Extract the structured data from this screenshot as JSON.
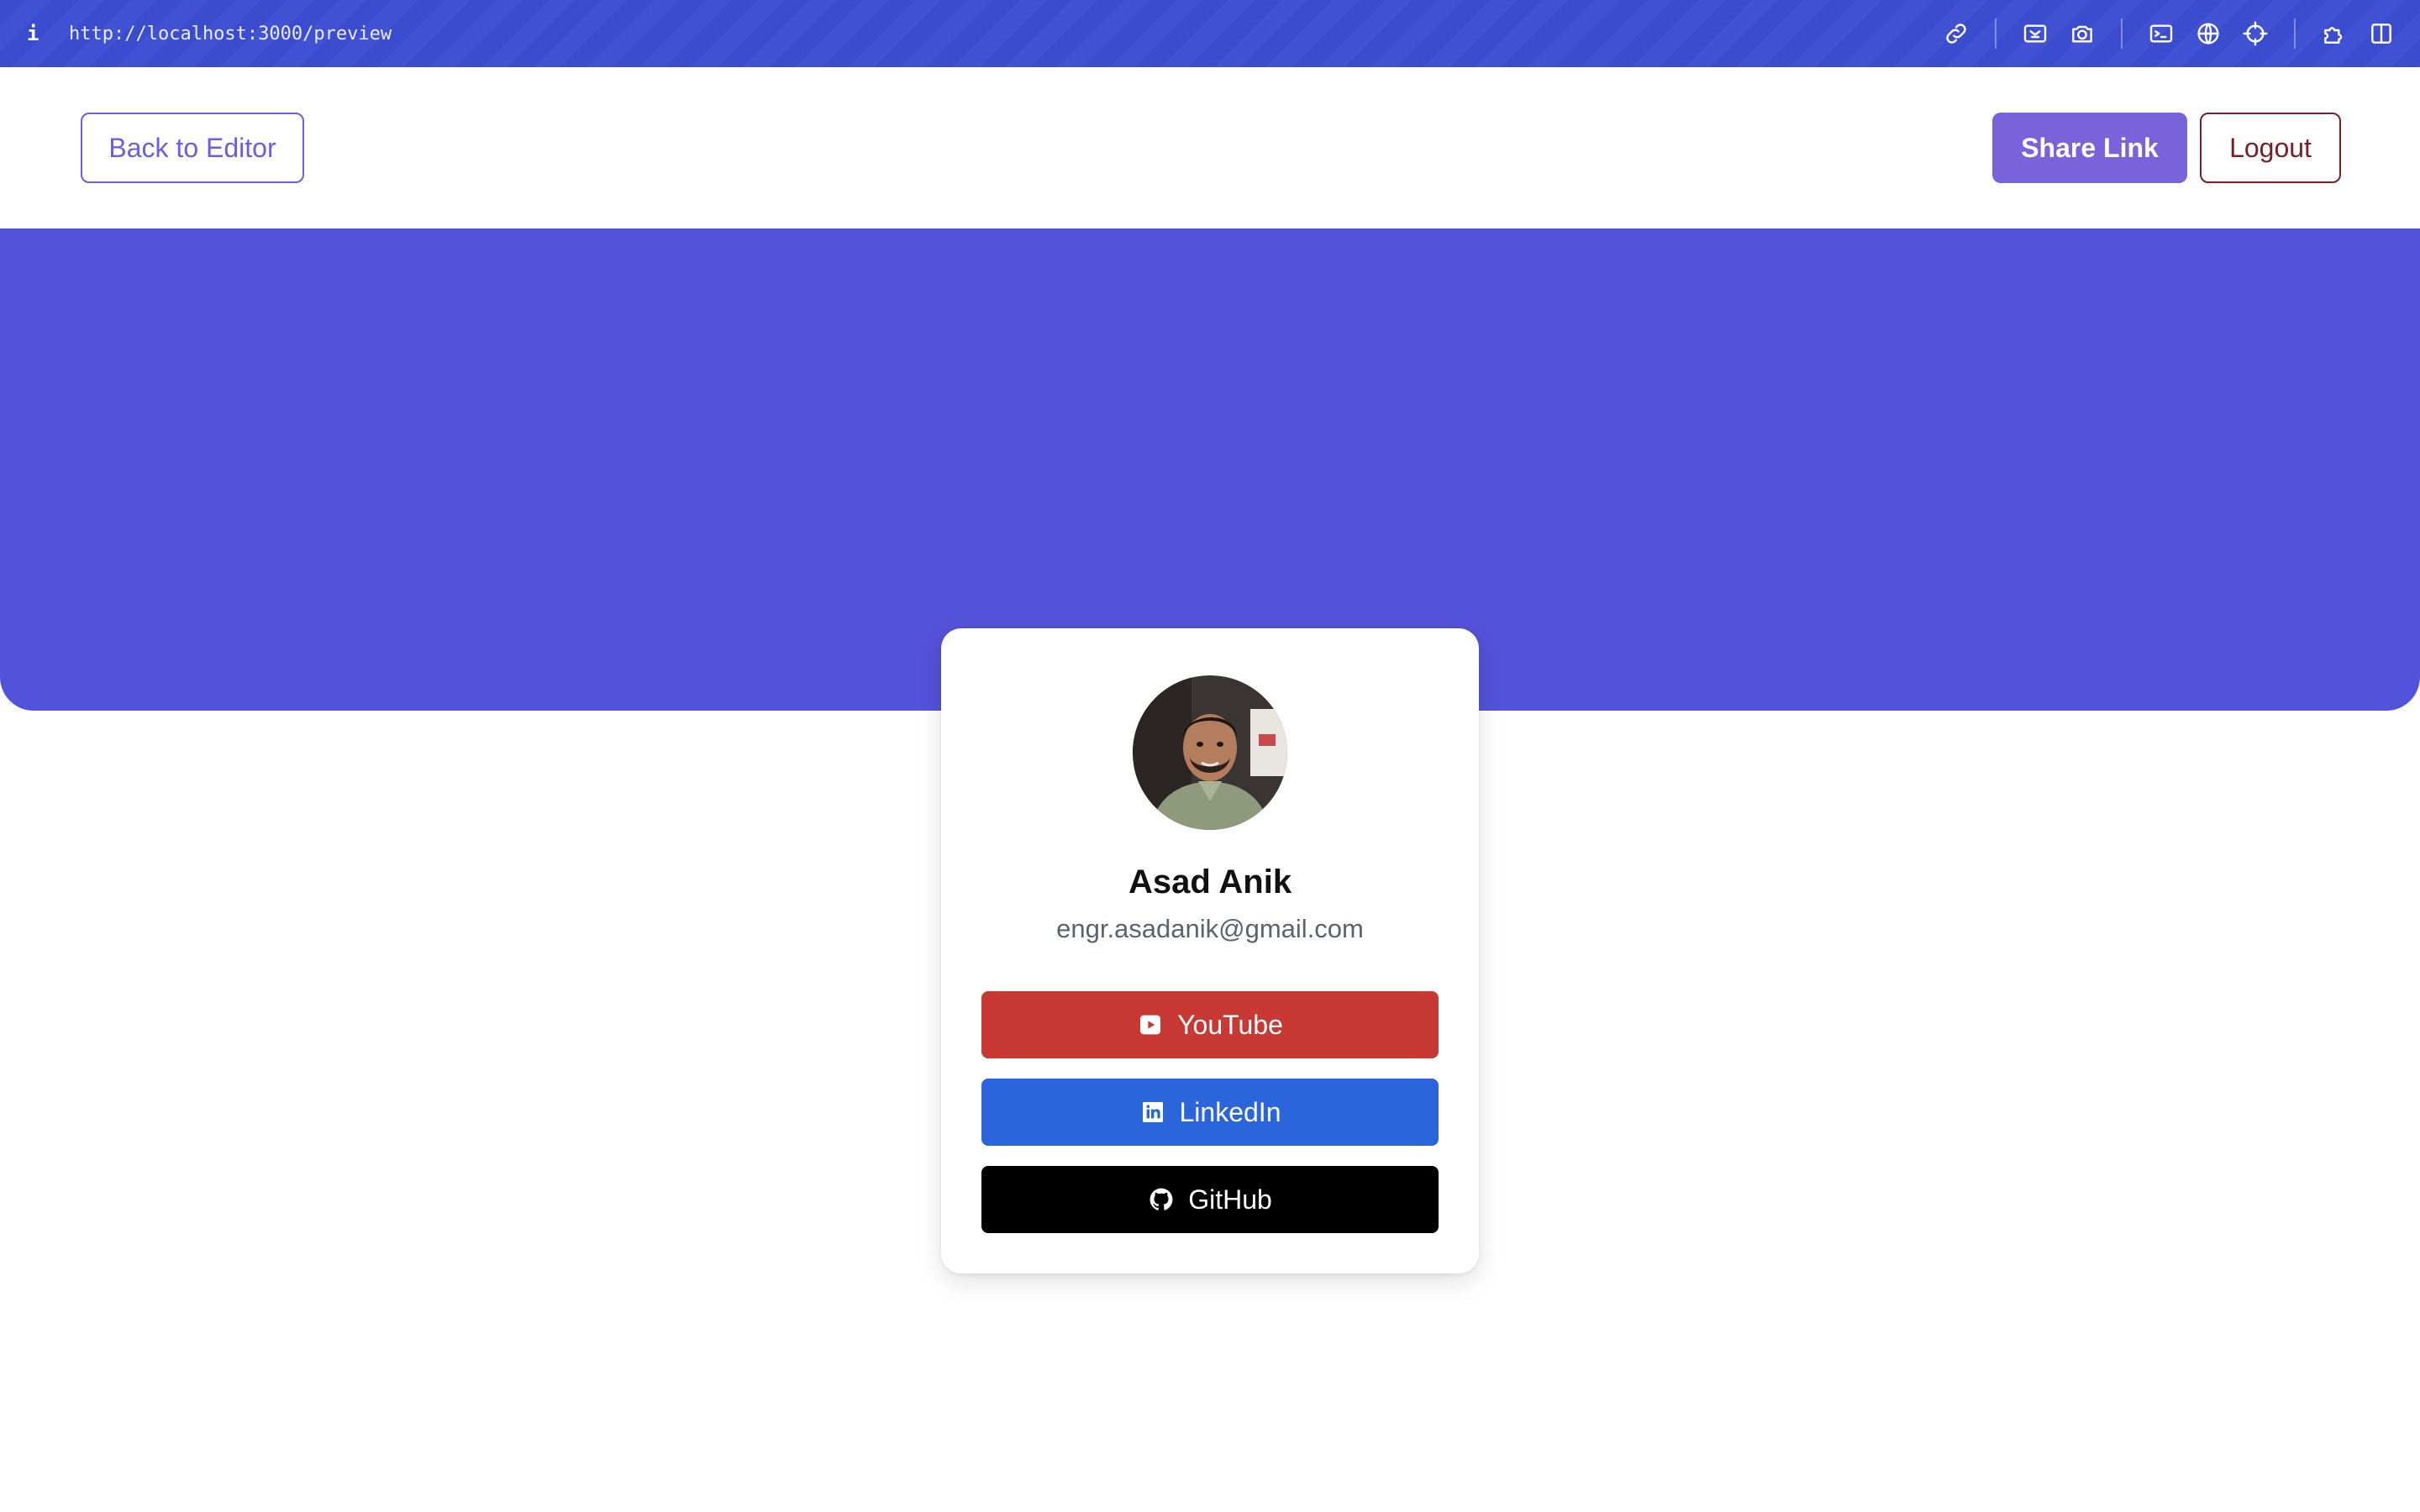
{
  "browser": {
    "url": "http://localhost:3000/preview",
    "info_glyph": "i",
    "tool_icons": [
      "link-icon",
      "screenshot-area-icon",
      "camera-icon",
      "terminal-icon",
      "globe-icon",
      "crosshair-icon",
      "extensions-icon",
      "split-view-icon"
    ]
  },
  "header": {
    "back_label": "Back to Editor",
    "share_label": "Share Link",
    "logout_label": "Logout"
  },
  "profile": {
    "name": "Asad Anik",
    "email": "engr.asadanik@gmail.com"
  },
  "links": [
    {
      "label": "YouTube",
      "icon": "youtube-icon",
      "color": "#c93934"
    },
    {
      "label": "LinkedIn",
      "icon": "linkedin-icon",
      "color": "#2a65dc"
    },
    {
      "label": "GitHub",
      "icon": "github-icon",
      "color": "#000000"
    }
  ],
  "colors": {
    "hero": "#5352da",
    "accent": "#6a5fe0",
    "share_button": "#7863db",
    "logout": "#7a1f26",
    "topbar": "#3c4cce"
  }
}
